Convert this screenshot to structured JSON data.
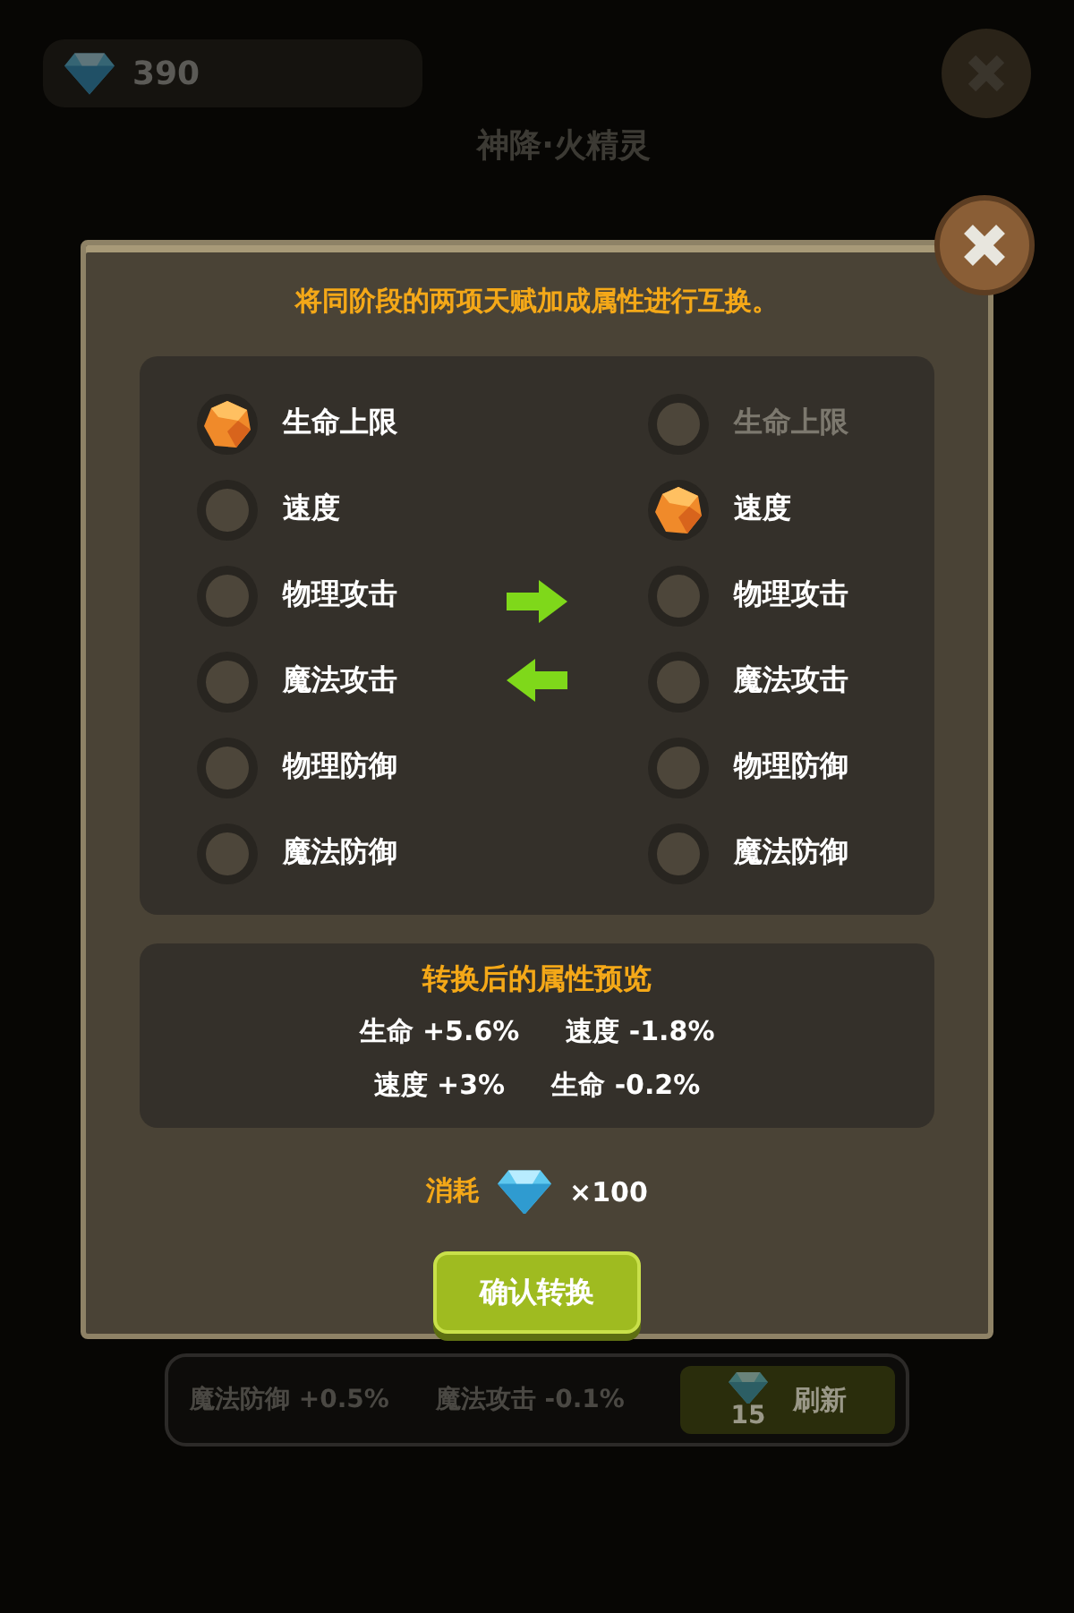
{
  "background": {
    "gems": "390",
    "title": "神降·火精灵",
    "stats": [
      "魔法防御 +0.5%",
      "魔法攻击 -0.1%"
    ],
    "refresh": {
      "cost": "15",
      "label": "刷新"
    }
  },
  "dialog": {
    "instruction": "将同阶段的两项天赋加成属性进行互换。",
    "left": [
      {
        "label": "生命上限",
        "selected": true,
        "disabled": false
      },
      {
        "label": "速度",
        "selected": false,
        "disabled": false
      },
      {
        "label": "物理攻击",
        "selected": false,
        "disabled": false
      },
      {
        "label": "魔法攻击",
        "selected": false,
        "disabled": false
      },
      {
        "label": "物理防御",
        "selected": false,
        "disabled": false
      },
      {
        "label": "魔法防御",
        "selected": false,
        "disabled": false
      }
    ],
    "right": [
      {
        "label": "生命上限",
        "selected": false,
        "disabled": true
      },
      {
        "label": "速度",
        "selected": true,
        "disabled": false
      },
      {
        "label": "物理攻击",
        "selected": false,
        "disabled": false
      },
      {
        "label": "魔法攻击",
        "selected": false,
        "disabled": false
      },
      {
        "label": "物理防御",
        "selected": false,
        "disabled": false
      },
      {
        "label": "魔法防御",
        "selected": false,
        "disabled": false
      }
    ],
    "preview": {
      "title": "转换后的属性预览",
      "lines": [
        [
          "生命 +5.6%",
          "速度 -1.8%"
        ],
        [
          "速度 +3%",
          "生命 -0.2%"
        ]
      ]
    },
    "cost": {
      "label": "消耗",
      "amount": "×100"
    },
    "confirm": "确认转换"
  }
}
